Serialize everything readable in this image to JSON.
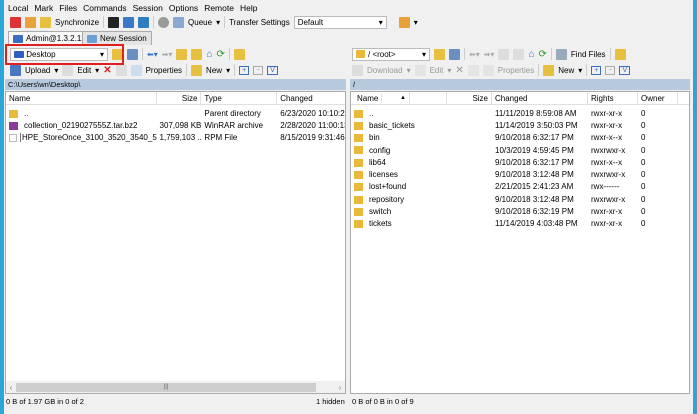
{
  "menu": [
    "Local",
    "Mark",
    "Files",
    "Commands",
    "Session",
    "Options",
    "Remote",
    "Help"
  ],
  "toolbar": {
    "synchronize": "Synchronize",
    "queue": "Queue",
    "transfer_settings": "Transfer Settings",
    "transfer_value": "Default"
  },
  "tabs": [
    {
      "label": "Admin@1.3.2.12"
    },
    {
      "label": "New Session"
    }
  ],
  "left": {
    "location": "Desktop",
    "actions": {
      "upload": "Upload",
      "edit": "Edit",
      "properties": "Properties",
      "new": "New"
    },
    "path": "C:\\Users\\wn\\Desktop\\",
    "columns": [
      "Name",
      "Size",
      "Type",
      "Changed"
    ],
    "rows": [
      {
        "name": "..",
        "size": "",
        "type": "Parent directory",
        "changed": "6/23/2020  10:10:26"
      },
      {
        "name": "collection_0219027555Z.tar.bz2",
        "size": "307,098 KB",
        "type": "WinRAR archive",
        "changed": "2/28/2020  11:00:13"
      },
      {
        "name": "HPE_StoreOnce_3100_3520_3540_510...",
        "size": "1,759,103 ...",
        "type": "RPM File",
        "changed": "8/15/2019  9:31:46 A"
      }
    ],
    "status": "0 B of 1.97 GB in 0 of 2",
    "hidden": "1 hidden"
  },
  "right": {
    "location": "/ <root>",
    "find_files": "Find Files",
    "actions": {
      "download": "Download",
      "edit": "Edit",
      "properties": "Properties",
      "new": "New"
    },
    "path": "/",
    "columns": [
      "Name",
      "Size",
      "Changed",
      "Rights",
      "Owner"
    ],
    "rows": [
      {
        "name": "..",
        "changed": "11/11/2019 8:59:08 AM",
        "rights": "rwxr-xr-x",
        "owner": "0"
      },
      {
        "name": "basic_tickets",
        "changed": "11/14/2019 3:50:03 PM",
        "rights": "rwxr-xr-x",
        "owner": "0"
      },
      {
        "name": "bin",
        "changed": "9/10/2018 6:32:17 PM",
        "rights": "rwxr-x--x",
        "owner": "0"
      },
      {
        "name": "config",
        "changed": "10/3/2019 4:59:45 PM",
        "rights": "rwxrwxr-x",
        "owner": "0"
      },
      {
        "name": "lib64",
        "changed": "9/10/2018 6:32:17 PM",
        "rights": "rwxr-x--x",
        "owner": "0"
      },
      {
        "name": "licenses",
        "changed": "9/10/2018 3:12:48 PM",
        "rights": "rwxrwxr-x",
        "owner": "0"
      },
      {
        "name": "lost+found",
        "changed": "2/21/2015 2:41:23 AM",
        "rights": "rwx------",
        "owner": "0"
      },
      {
        "name": "repository",
        "changed": "9/10/2018 3:12:48 PM",
        "rights": "rwxrwxr-x",
        "owner": "0"
      },
      {
        "name": "switch",
        "changed": "9/10/2018 6:32:19 PM",
        "rights": "rwxr-xr-x",
        "owner": "0"
      },
      {
        "name": "tickets",
        "changed": "11/14/2019 4:03:48 PM",
        "rights": "rwxr-xr-x",
        "owner": "0"
      }
    ],
    "status": "0 B of 0 B in 0 of 9"
  }
}
